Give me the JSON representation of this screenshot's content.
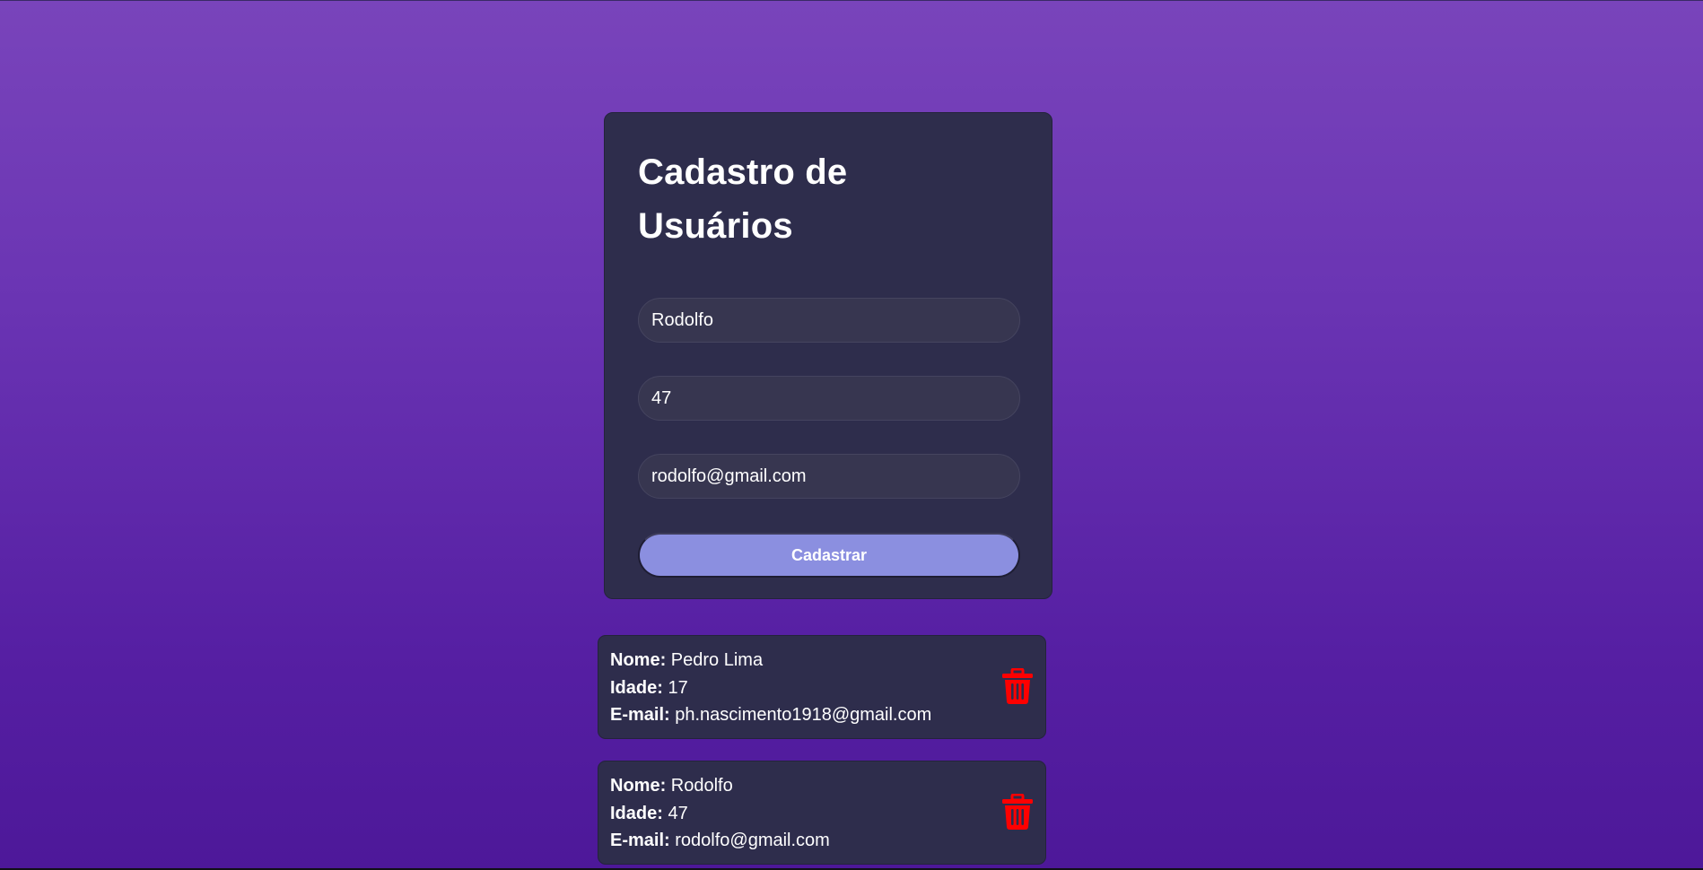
{
  "form": {
    "title": "Cadastro de Usuários",
    "name_value": "Rodolfo",
    "age_value": "47",
    "email_value": "rodolfo@gmail.com",
    "submit_label": "Cadastrar"
  },
  "labels": {
    "name": "Nome:",
    "age": "Idade:",
    "email": "E-mail:"
  },
  "users": [
    {
      "name": "Pedro Lima",
      "age": "17",
      "email": "ph.nascimento1918@gmail.com"
    },
    {
      "name": "Rodolfo",
      "age": "47",
      "email": "rodolfo@gmail.com"
    }
  ],
  "icons": {
    "delete": "trash-icon"
  },
  "colors": {
    "background_top": "#7944bb",
    "background_bottom": "#4d1899",
    "card": "#2e2d4c",
    "input": "#373650",
    "button": "#8b8fe0",
    "delete": "#ff0000"
  }
}
